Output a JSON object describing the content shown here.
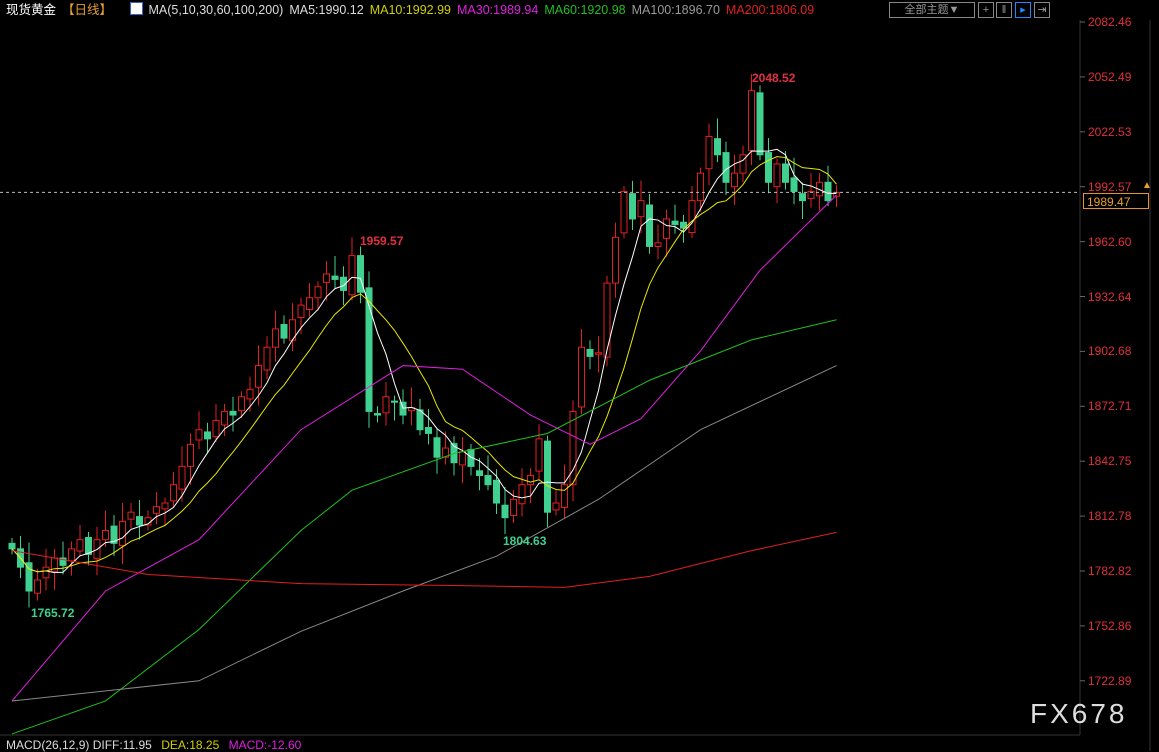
{
  "header": {
    "title": "现货黄金",
    "period": "【日线】",
    "ma_label": "MA(5,10,30,60,100,200)",
    "ma5": "MA5:1990.12",
    "ma10": "MA10:1992.99",
    "ma30": "MA30:1989.94",
    "ma60": "MA60:1920.98",
    "ma100": "MA100:1896.70",
    "ma200": "MA200:1806.09",
    "theme_select": "全部主题▼"
  },
  "colors": {
    "ma5": "#ffffff",
    "ma10": "#e8e800",
    "ma30": "#e020e0",
    "ma60": "#20c020",
    "ma100": "#888888",
    "ma200": "#e02020",
    "up": "#e02020",
    "down": "#40d090"
  },
  "y_axis": [
    "2082.46",
    "2052.49",
    "2022.53",
    "1992.57",
    "1962.60",
    "1932.64",
    "1902.68",
    "1872.71",
    "1842.75",
    "1812.78",
    "1782.82",
    "1752.86",
    "1722.89"
  ],
  "current_price": "1989.47",
  "annotations": {
    "high1": "1959.57",
    "high2": "2048.52",
    "low1": "1765.72",
    "low2": "1804.63"
  },
  "footer": {
    "macd": "MACD(26,12,9)",
    "diff": "DIFF:11.95",
    "dea": "DEA:18.25",
    "macd_val": "MACD:-12.60"
  },
  "logo": "FX678",
  "chart_data": {
    "type": "candlestick",
    "ylim": [
      1722.89,
      2082.46
    ],
    "closes": [
      1795,
      1785,
      1772,
      1778,
      1785,
      1790,
      1786,
      1795,
      1800,
      1792,
      1800,
      1805,
      1798,
      1810,
      1815,
      1808,
      1812,
      1818,
      1820,
      1830,
      1840,
      1852,
      1860,
      1855,
      1865,
      1870,
      1868,
      1878,
      1882,
      1895,
      1905,
      1915,
      1910,
      1920,
      1928,
      1932,
      1938,
      1945,
      1942,
      1936,
      1955,
      1935,
      1870,
      1868,
      1878,
      1875,
      1868,
      1872,
      1860,
      1858,
      1845,
      1850,
      1842,
      1848,
      1840,
      1835,
      1830,
      1820,
      1812,
      1822,
      1830,
      1835,
      1855,
      1815,
      1820,
      1830,
      1870,
      1905,
      1900,
      1902,
      1940,
      1965,
      1990,
      1975,
      1985,
      1960,
      1962,
      1975,
      1972,
      1970,
      1985,
      2000,
      2020,
      2010,
      1995,
      2000,
      2010,
      2045,
      2010,
      1995,
      2005,
      1995,
      1990,
      1985,
      1990,
      1995,
      1985,
      1989.47
    ],
    "ma30": [
      [
        0,
        1712
      ],
      [
        11,
        1772
      ],
      [
        22,
        1800
      ],
      [
        34,
        1860
      ],
      [
        46,
        1895
      ],
      [
        53,
        1893
      ],
      [
        61,
        1868
      ],
      [
        68,
        1852
      ],
      [
        74,
        1866
      ],
      [
        81,
        1903
      ],
      [
        88,
        1947
      ],
      [
        97,
        1988
      ]
    ],
    "ma60": [
      [
        0,
        1694
      ],
      [
        11,
        1712
      ],
      [
        22,
        1751
      ],
      [
        34,
        1805
      ],
      [
        40,
        1827
      ],
      [
        52,
        1847
      ],
      [
        63,
        1858
      ],
      [
        75,
        1887
      ],
      [
        87,
        1909
      ],
      [
        97,
        1920
      ]
    ],
    "ma100": [
      [
        0,
        1712
      ],
      [
        22,
        1723
      ],
      [
        34,
        1750
      ],
      [
        46,
        1772
      ],
      [
        57,
        1791
      ],
      [
        69,
        1822
      ],
      [
        81,
        1860
      ],
      [
        97,
        1895
      ]
    ],
    "ma200": [
      [
        0,
        1794
      ],
      [
        16,
        1781
      ],
      [
        34,
        1776
      ],
      [
        52,
        1775
      ],
      [
        65,
        1774
      ],
      [
        75,
        1780
      ],
      [
        87,
        1794
      ],
      [
        97,
        1804
      ]
    ]
  }
}
